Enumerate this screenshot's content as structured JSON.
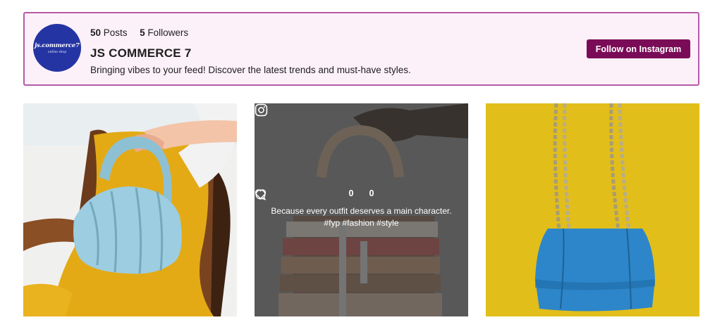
{
  "header": {
    "avatar_brand": "js.commerce7",
    "avatar_sub": "online shop",
    "posts_count": "50",
    "posts_label": "Posts",
    "followers_count": "5",
    "followers_label": "Followers",
    "title": "JS COMMERCE 7",
    "bio": "Bringing vibes to your feed! Discover the latest trends and must-have styles.",
    "follow_label": "Follow on Instagram"
  },
  "posts": [
    {
      "id": 1
    },
    {
      "id": 2,
      "likes": "0",
      "comments": "0",
      "caption_line1": "Because every outfit deserves a main character.",
      "caption_line2": "#fyp #fashion #style"
    },
    {
      "id": 3
    }
  ],
  "colors": {
    "accent": "#7a0c57",
    "header_bg": "#fdf1f9",
    "header_border": "#b45aa6"
  }
}
